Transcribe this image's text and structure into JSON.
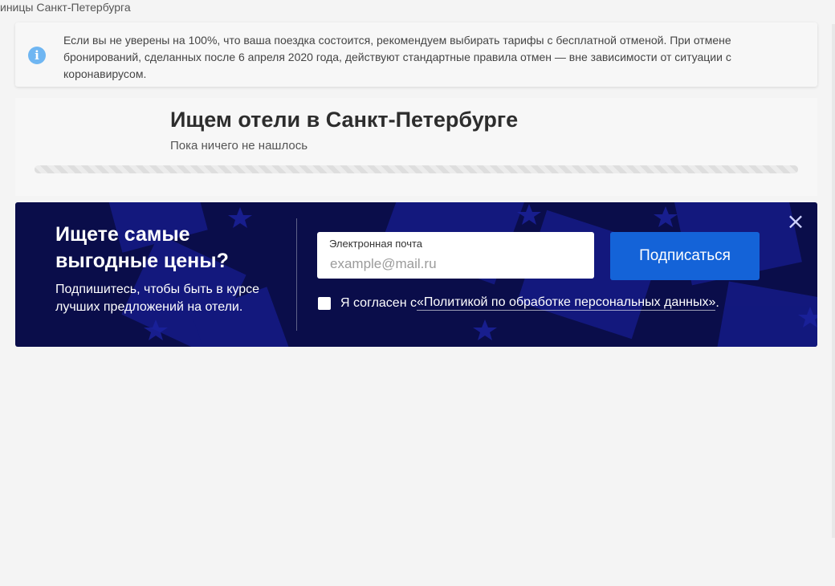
{
  "breadcrumb": "иницы Санкт-Петербурга",
  "info": {
    "icon": "info-icon",
    "text": "Если вы не уверены на 100%, что ваша поездка состоится, рекомендуем выбирать тарифы с бесплатной отменой. При отмене бронирований, сделанных после 6 апреля 2020 года, действуют стандартные правила отмен — вне зависимости от ситуации с коронавирусом."
  },
  "search": {
    "title": "Ищем отели в Санкт-Петербурге",
    "status": "Пока ничего не нашлось"
  },
  "promo": {
    "title": "Ищете самые выгодные цены?",
    "subtitle": "Подпишитесь, чтобы быть в курсе лучших предложений на отели.",
    "email_label": "Электронная почта",
    "email_placeholder": "example@mail.ru",
    "email_value": "",
    "subscribe_label": "Подписаться",
    "consent_prefix": "Я согласен с ",
    "consent_link": "«Политикой по обработке персональных данных»",
    "consent_suffix": ".",
    "consent_checked": false,
    "close_icon": "close-icon",
    "colors": {
      "background": "#0a0d4a",
      "pattern": "#1a1f9e",
      "button": "#1463d8"
    }
  }
}
